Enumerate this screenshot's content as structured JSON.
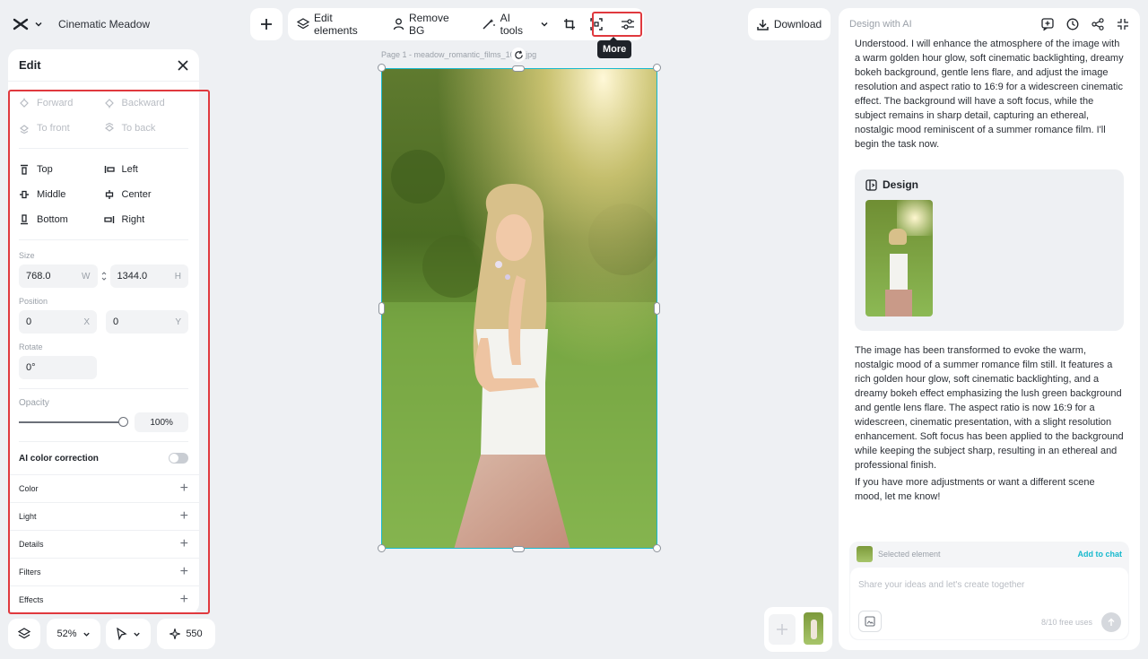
{
  "app": {
    "doc_title": "Cinematic Meadow"
  },
  "toolbar": {
    "edit_elements": "Edit elements",
    "remove_bg": "Remove BG",
    "ai_tools": "AI tools",
    "more_tooltip": "More",
    "download": "Download"
  },
  "edit_panel": {
    "title": "Edit",
    "layer_items": [
      {
        "label": "Forward",
        "icon": "forward-icon"
      },
      {
        "label": "Backward",
        "icon": "backward-icon"
      },
      {
        "label": "To front",
        "icon": "to-front-icon"
      },
      {
        "label": "To back",
        "icon": "to-back-icon"
      }
    ],
    "align_items": [
      {
        "label": "Top",
        "icon": "align-top-icon"
      },
      {
        "label": "Left",
        "icon": "align-left-icon"
      },
      {
        "label": "Middle",
        "icon": "align-middle-icon"
      },
      {
        "label": "Center",
        "icon": "align-center-icon"
      },
      {
        "label": "Bottom",
        "icon": "align-bottom-icon"
      },
      {
        "label": "Right",
        "icon": "align-right-icon"
      }
    ],
    "size_label": "Size",
    "width": "768.0",
    "width_unit": "W",
    "height": "1344.0",
    "height_unit": "H",
    "position_label": "Position",
    "pos_x": "0",
    "pos_x_unit": "X",
    "pos_y": "0",
    "pos_y_unit": "Y",
    "rotate_label": "Rotate",
    "rotate": "0°",
    "opacity_label": "Opacity",
    "opacity": "100%",
    "opacity_level": 1.0,
    "ai_color_correction": "AI color correction",
    "sections": [
      "Color",
      "Light",
      "Details",
      "Filters",
      "Effects"
    ]
  },
  "bottom_controls": {
    "zoom": "52%",
    "credits": "550"
  },
  "canvas": {
    "page_label": "Page 1 -   meadow_romantic_films_16_9.jpg"
  },
  "ai_panel": {
    "title": "Design with AI",
    "message_1": "Understood. I will enhance the atmosphere of the image with a warm golden hour glow, soft cinematic backlighting, dreamy bokeh background, gentle lens flare, and adjust the image resolution and aspect ratio to 16:9 for a widescreen cinematic effect. The background will have a soft focus, while the subject remains in sharp detail, capturing an ethereal, nostalgic mood reminiscent of a summer romance film. I'll begin the task now.",
    "design_card_title": "Design",
    "message_2": "The image has been transformed to evoke the warm, nostalgic mood of a summer romance film still. It features a rich golden hour glow, soft cinematic backlighting, and a dreamy bokeh effect emphasizing the lush green background and gentle lens flare. The aspect ratio is now 16:9 for a widescreen, cinematic presentation, with a slight resolution enhancement. Soft focus has been applied to the background while keeping the subject sharp, resulting in an ethereal and professional finish.",
    "message_3": "If you have more adjustments or want a different scene mood, let me know!",
    "selected_element": "Selected element",
    "add_to_chat": "Add to chat",
    "input_placeholder": "Share your ideas and let's create together",
    "free_uses": "8/10 free uses"
  },
  "colors": {
    "accent": "#17b9cd",
    "highlight": "#e0393e"
  }
}
